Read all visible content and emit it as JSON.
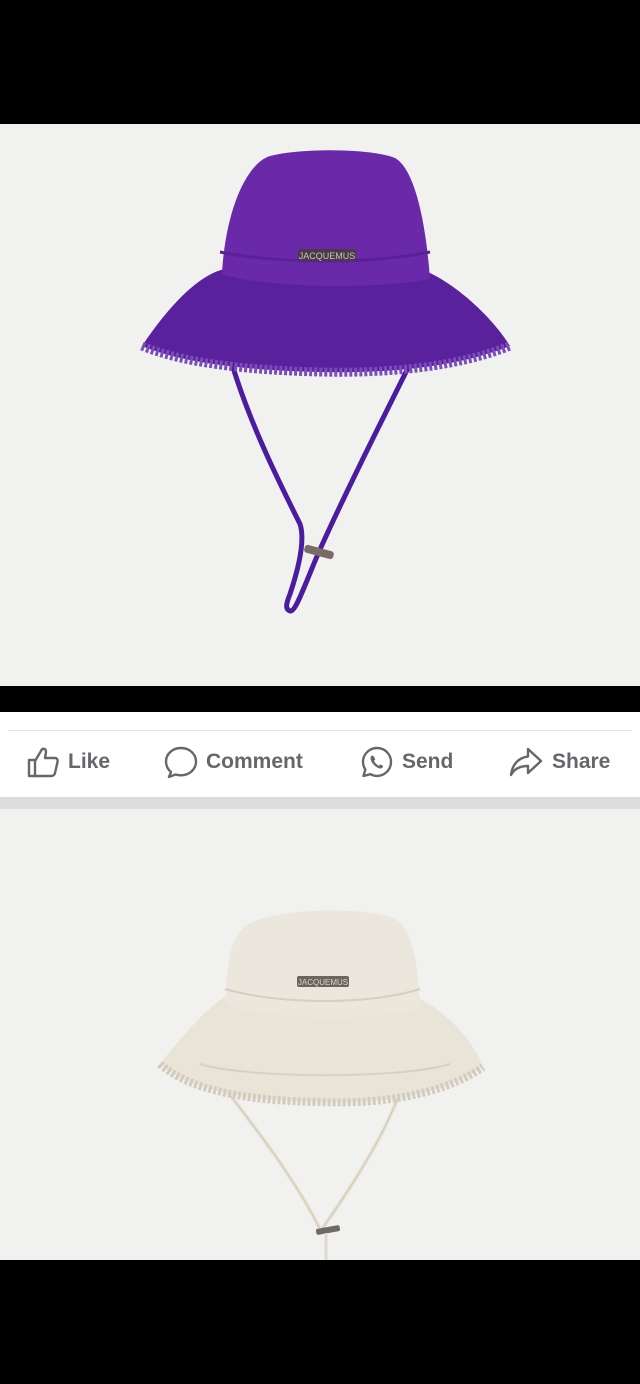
{
  "post": {
    "photos": [
      {
        "subject": "purple-bucket-hat",
        "hat_color": "#5b1fa0",
        "logo_text": "JACQUEMUS"
      },
      {
        "subject": "beige-bucket-hat",
        "hat_color": "#e7e1d3",
        "logo_text": "JACQUEMUS"
      }
    ]
  },
  "actions": {
    "like": {
      "label": "Like",
      "icon": "thumbs-up-icon"
    },
    "comment": {
      "label": "Comment",
      "icon": "speech-bubble-icon"
    },
    "send": {
      "label": "Send",
      "icon": "whatsapp-icon"
    },
    "share": {
      "label": "Share",
      "icon": "share-arrow-icon"
    }
  },
  "colors": {
    "action_text": "#65676b",
    "background": "#000000",
    "photo_bg": "#f1f1f0"
  }
}
